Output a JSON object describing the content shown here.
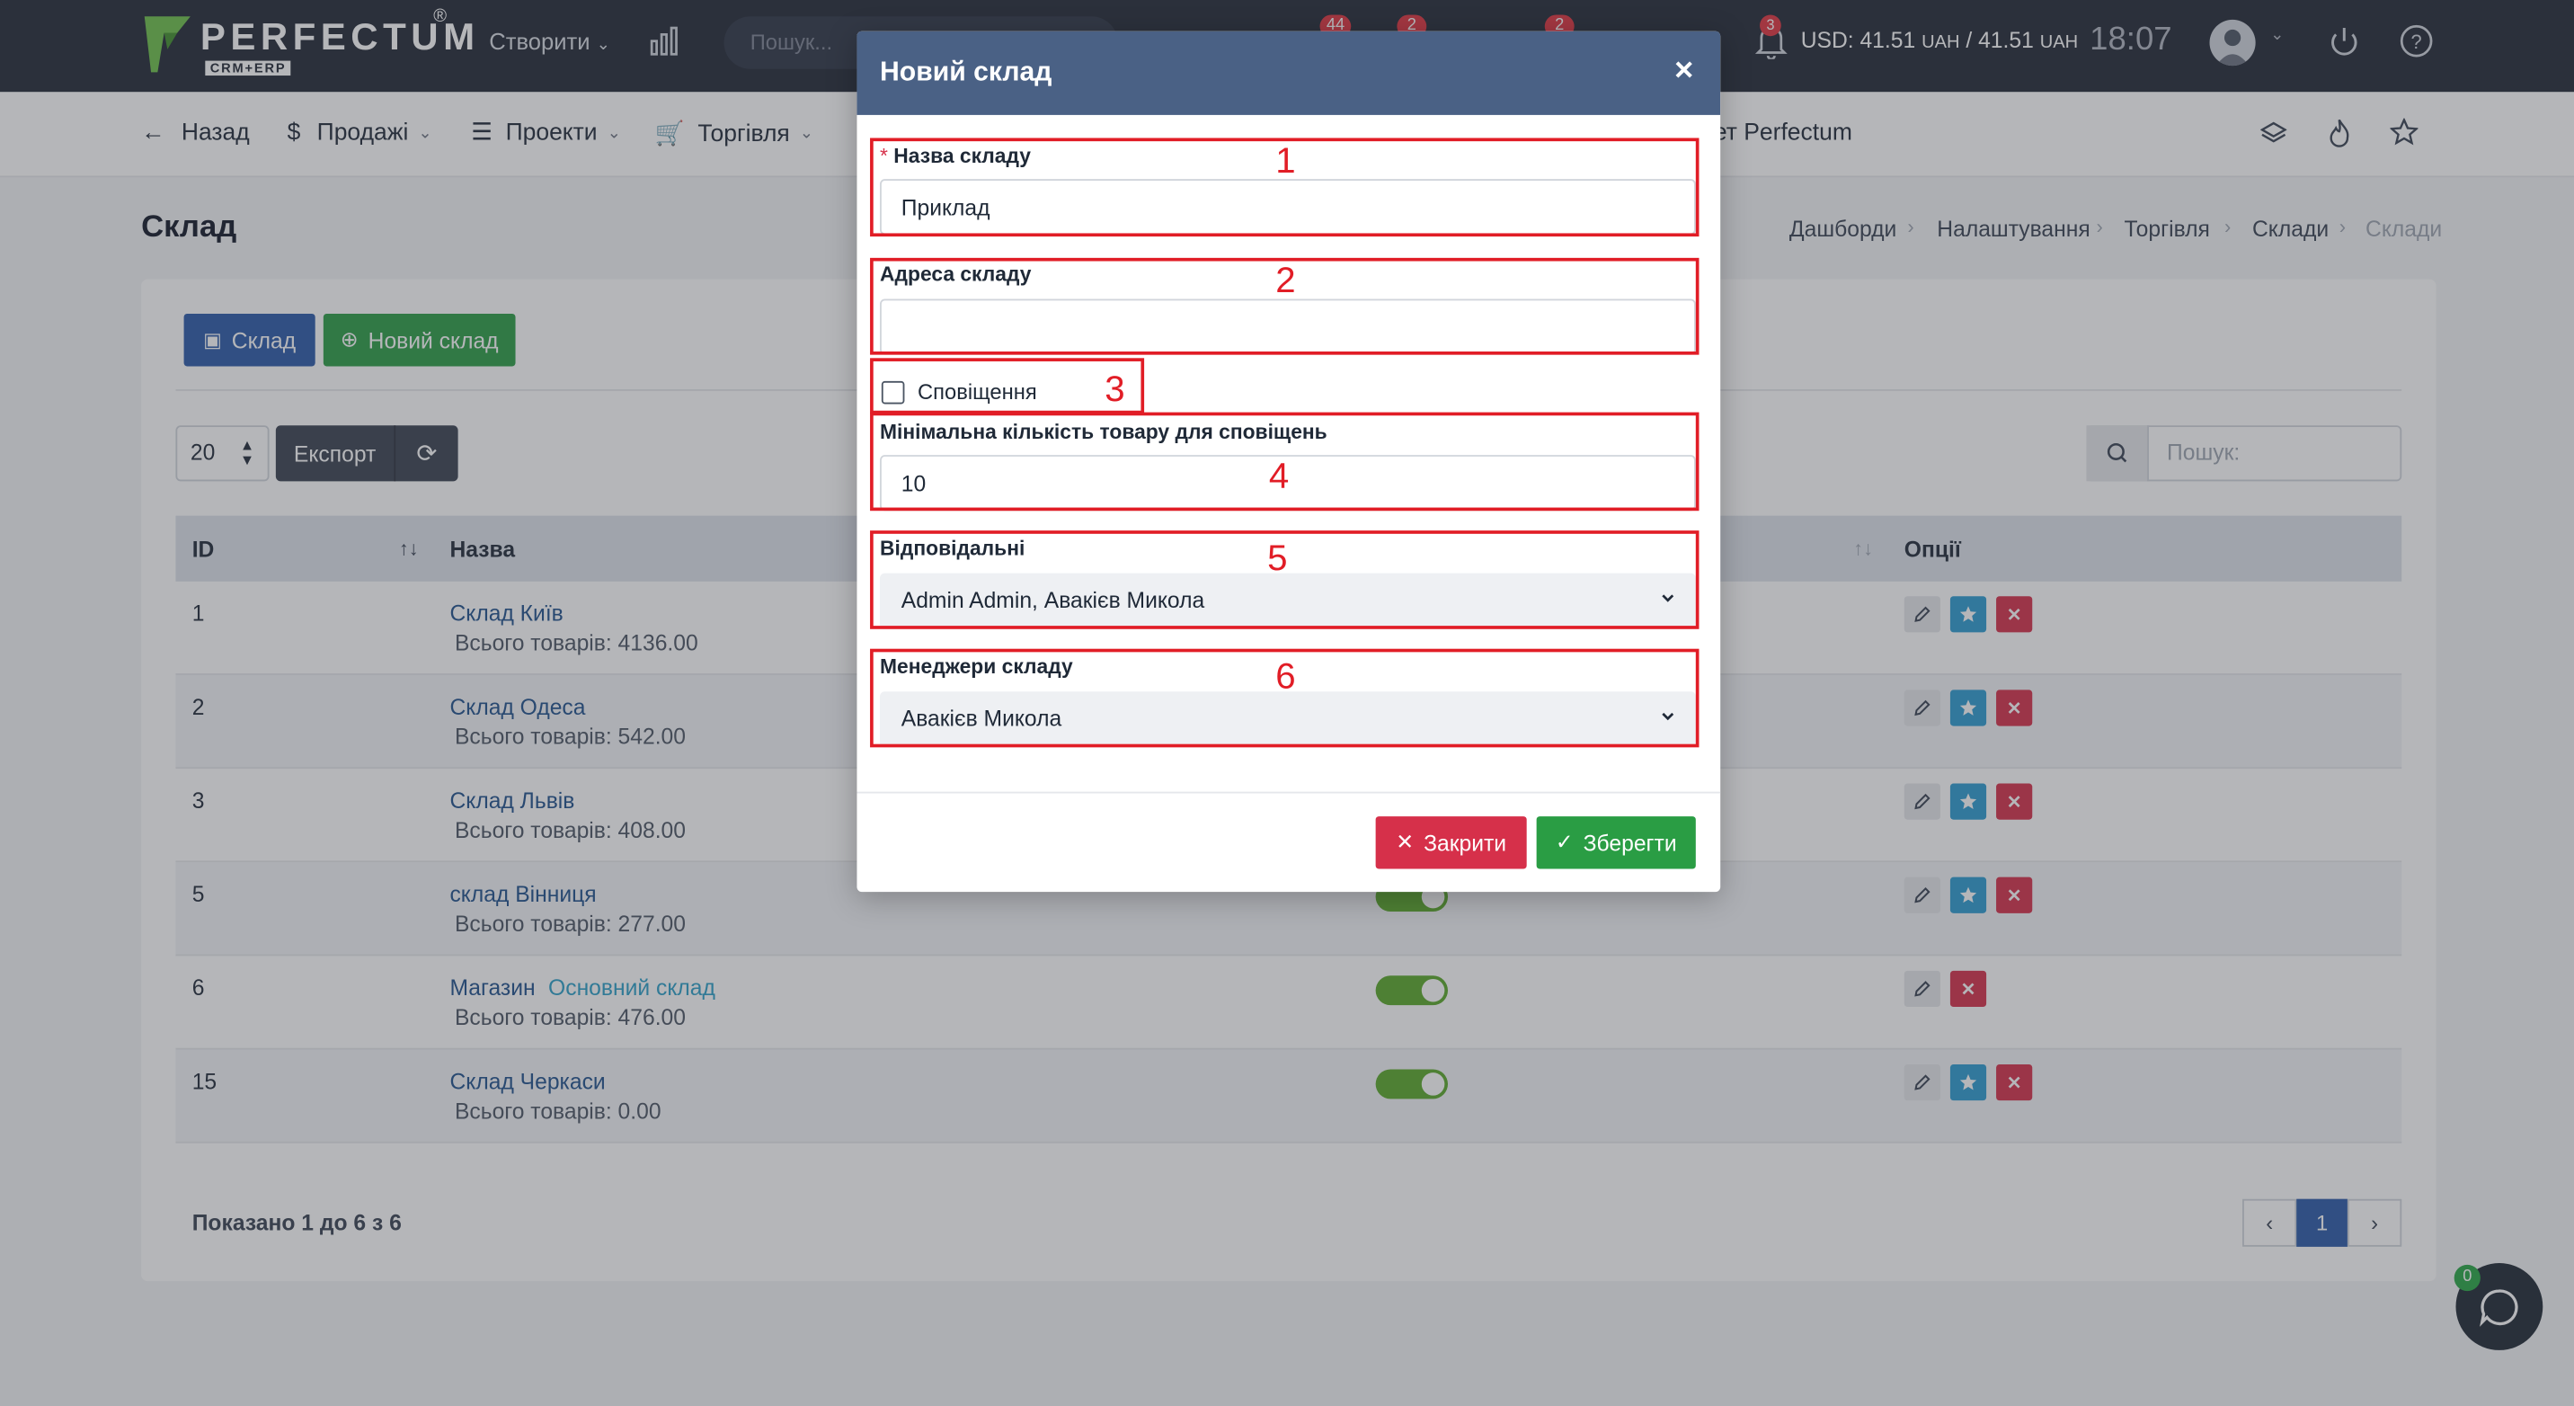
{
  "colors": {
    "topbar": "#212734",
    "accent_blue": "#2a5aa8",
    "green": "#2a9d44",
    "red": "#d6304a",
    "modal_header": "#4a6185",
    "annotation_red": "#e11d26"
  },
  "topbar": {
    "logo": "PERFECTUM",
    "logo_sub": "CRM+ERP",
    "logo_reg": "®",
    "create": "Створити",
    "search_placeholder": "Пошук...",
    "badges": [
      "44",
      "2",
      "2"
    ],
    "bell_badge": "3",
    "currency_main": "USD: 41.51",
    "currency_unit1": "UAH",
    "currency_mid": "/ 41.51",
    "currency_unit2": "UAH",
    "time": "18:07"
  },
  "nav": {
    "back": "Назад",
    "sales": "Продажі",
    "projects": "Проекти",
    "trade": "Торгівля",
    "tail": "ет Perfectum"
  },
  "page": {
    "title": "Склад",
    "breadcrumbs": [
      "Дашборди",
      "Налаштування",
      "Торгівля",
      "Склади",
      "Склади"
    ]
  },
  "toolbar": {
    "warehouse_btn": "Склад",
    "new_warehouse_btn": "Новий склад",
    "page_length": "20",
    "export": "Експорт",
    "search_placeholder": "Пошук:"
  },
  "table": {
    "headers": {
      "id": "ID",
      "name": "Назва",
      "options": "Опції"
    },
    "rows": [
      {
        "id": "1",
        "name": "Склад Київ",
        "tag": "",
        "sub": "Всього товарів: 4136.00",
        "star": true
      },
      {
        "id": "2",
        "name": "Склад Одеса",
        "tag": "",
        "sub": "Всього товарів: 542.00",
        "star": true
      },
      {
        "id": "3",
        "name": "Склад Львів",
        "tag": "",
        "sub": "Всього товарів: 408.00",
        "star": true
      },
      {
        "id": "5",
        "name": "склад Вінниця",
        "tag": "",
        "sub": "Всього товарів: 277.00",
        "star": true
      },
      {
        "id": "6",
        "name": "Магазин",
        "tag": "Основний склад",
        "sub": "Всього товарів: 476.00",
        "star": false
      },
      {
        "id": "15",
        "name": "Склад Черкаси",
        "tag": "",
        "sub": "Всього товарів: 0.00",
        "star": true
      }
    ],
    "showing": "Показано 1 до 6 з 6",
    "current_page": "1"
  },
  "chat_badge": "0",
  "modal": {
    "title": "Новий склад",
    "close_x": "×",
    "required_mark": "*",
    "name_label": "Назва складу",
    "name_value": "Приклад",
    "address_label": "Адреса складу",
    "address_value": "",
    "notify_label": "Сповіщення",
    "min_qty_label": "Мінімальна кількість товару для сповіщень",
    "min_qty_value": "10",
    "responsible_label": "Відповідальні",
    "responsible_value": "Admin Admin, Авакієв Микола",
    "managers_label": "Менеджери складу",
    "managers_value": "Авакієв Микола",
    "close_btn": "Закрити",
    "save_btn": "Зберегти"
  },
  "annotations": [
    "1",
    "2",
    "3",
    "4",
    "5",
    "6"
  ]
}
